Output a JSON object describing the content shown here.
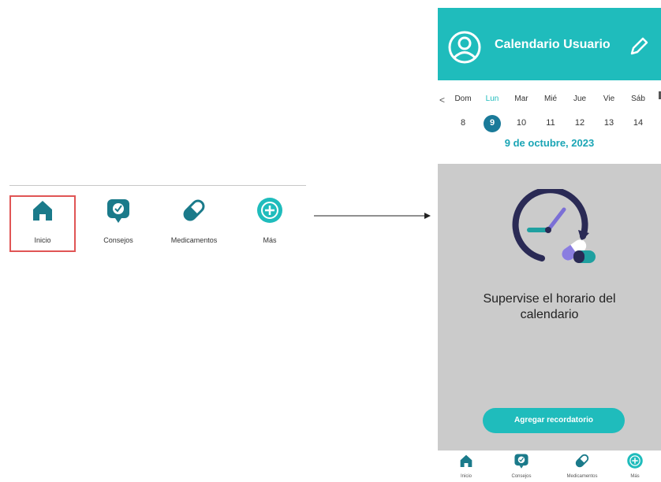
{
  "left_nav": {
    "items": [
      {
        "label": "Inicio",
        "icon": "home-icon"
      },
      {
        "label": "Consejos",
        "icon": "tips-chat-icon"
      },
      {
        "label": "Medicamentos",
        "icon": "pill-icon"
      },
      {
        "label": "Más",
        "icon": "plus-circle-icon"
      }
    ],
    "selected": "Inicio"
  },
  "phone": {
    "header": {
      "title": "Calendario Usuario",
      "avatar_icon": "user-avatar-icon",
      "edit_icon": "pencil-icon"
    },
    "calendar": {
      "prev": "<",
      "days": [
        {
          "dow": "Dom",
          "num": "8"
        },
        {
          "dow": "Lun",
          "num": "9"
        },
        {
          "dow": "Mar",
          "num": "10"
        },
        {
          "dow": "Mié",
          "num": "11"
        },
        {
          "dow": "Jue",
          "num": "12"
        },
        {
          "dow": "Vie",
          "num": "13"
        },
        {
          "dow": "Sáb",
          "num": "14"
        }
      ],
      "selected_date": "9 de octubre, 2023"
    },
    "headline": "Supervise el horario del calendario",
    "reminder_button": "Agregar recordatorio",
    "bottom_nav": [
      {
        "label": "Inicio"
      },
      {
        "label": "Consejos"
      },
      {
        "label": "Medicamentos"
      },
      {
        "label": "Más"
      }
    ]
  },
  "colors": {
    "accent": "#1fbcbc",
    "dark_teal": "#1a7a99",
    "highlight_border": "#e05555",
    "body_gray": "#cbcbcb"
  }
}
